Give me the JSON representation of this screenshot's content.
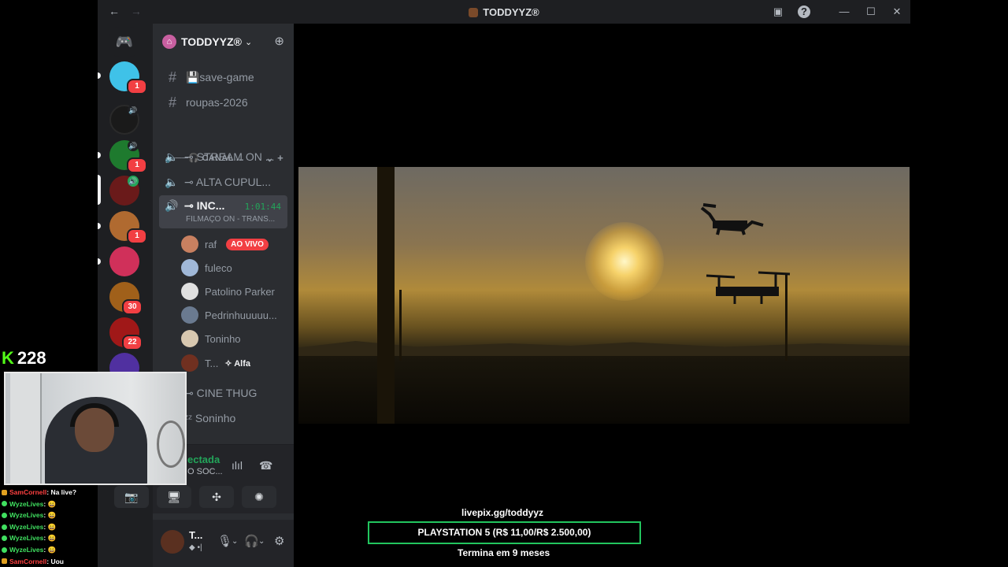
{
  "window": {
    "title": "TODDYYZ®",
    "back": "←",
    "forward": "→"
  },
  "guild": {
    "name": "TODDYYZ®",
    "chevron": "⌄",
    "invite": "👤+"
  },
  "rail": {
    "home_icon": "discord-logo-icon",
    "servers": [
      {
        "color": "#3fc2e8",
        "badge": "1"
      },
      {
        "color": "#1a1a1a",
        "speaker": true
      },
      {
        "color": "#1e7a2e",
        "speaker": true,
        "badge": "1"
      },
      {
        "color": "#6a1a1a",
        "speaker": true,
        "speaker_green": true
      },
      {
        "color": "#b06a30",
        "badge": "1"
      },
      {
        "color": "#d0305a"
      },
      {
        "color": "#a0601a",
        "badge": "30"
      },
      {
        "color": "#a01818",
        "badge": "22"
      }
    ]
  },
  "channels": {
    "text": [
      {
        "label": "💾save-game"
      },
      {
        "label": "roupas-2026"
      }
    ],
    "category": "╭───🎧 CANAL ...",
    "voice": [
      {
        "label": "⊸ STREAM ON ..."
      },
      {
        "label": "⊸ ALTA CUPUL..."
      },
      {
        "label": "⊸ INC...",
        "timer": "1:01:44",
        "activity": "FILMAÇO ON - TRANS..."
      }
    ],
    "voice_users": [
      {
        "name": "raf",
        "live": "AO VIVO",
        "color": "#c88060"
      },
      {
        "name": "fuleco",
        "color": "#a0b8d8"
      },
      {
        "name": "Patolino Parker",
        "color": "#e0e0e0"
      },
      {
        "name": "Pedrinhuuuuu...",
        "color": "#6a7a90"
      },
      {
        "name": "Toninho",
        "color": "#d8c8b0"
      },
      {
        "name": "T...",
        "role": "✧ Alfa",
        "color": "#703020"
      }
    ],
    "more_voice": [
      {
        "label": "⊸ CINE THUG"
      },
      {
        "label": "ᶻᶻ Soninho"
      }
    ]
  },
  "voice_panel": {
    "status": "ectada",
    "sub": "O SOC..."
  },
  "user_panel": {
    "name": "T...",
    "status": "◆ •|"
  },
  "livepix": {
    "url": "livepix.gg/toddyyz",
    "goal": "PLAYSTATION 5 (R$ 11,00/R$ 2.500,00)",
    "ends": "Termina em 9 meses"
  },
  "overlay": {
    "viewer_count": "228",
    "platform_icon": "K",
    "chat": [
      {
        "user": "SamCornell",
        "msg": ": Na live?",
        "color": "#ff4040",
        "icon": "#e0a020"
      },
      {
        "user": "WyzeLives",
        "msg": ": 😄",
        "color": "#40e060",
        "icon": "#40e060"
      },
      {
        "user": "WyzeLives",
        "msg": ": 😄",
        "color": "#40e060",
        "icon": "#40e060"
      },
      {
        "user": "WyzeLives",
        "msg": ": 😄",
        "color": "#40e060",
        "icon": "#40e060"
      },
      {
        "user": "WyzeLives",
        "msg": ": 😄",
        "color": "#40e060",
        "icon": "#40e060"
      },
      {
        "user": "WyzeLives",
        "msg": ": 😄",
        "color": "#40e060",
        "icon": "#40e060"
      },
      {
        "user": "SamCornell",
        "msg": ": Uou",
        "color": "#ff4040",
        "icon": "#e0a020"
      }
    ]
  }
}
